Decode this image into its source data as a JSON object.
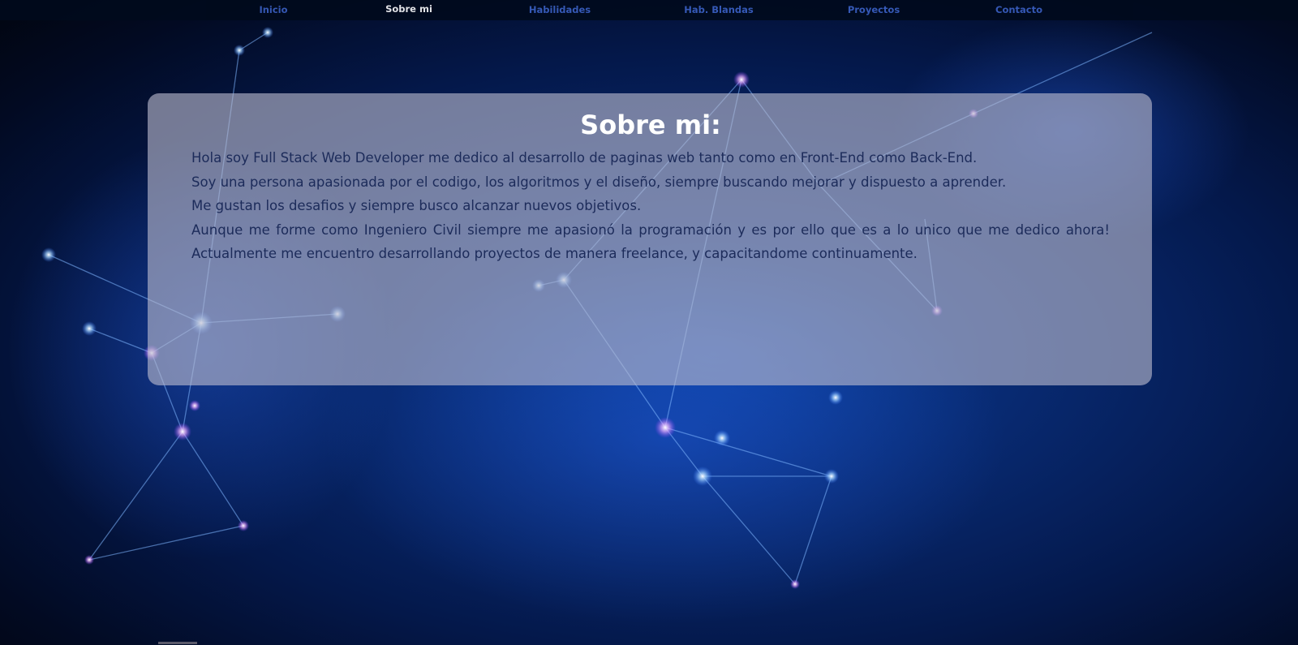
{
  "nav": {
    "items": [
      {
        "label": "Inicio"
      },
      {
        "label": "Sobre mi"
      },
      {
        "label": "Habilidades"
      },
      {
        "label": "Hab. Blandas"
      },
      {
        "label": "Proyectos"
      },
      {
        "label": "Contacto"
      }
    ],
    "active_index": 1
  },
  "about": {
    "title": "Sobre mi:",
    "paragraphs": [
      "Hola soy Full Stack Web Developer me dedico al desarrollo de paginas web tanto como en Front-End como Back-End.",
      "Soy una persona apasionada por el codigo, los algoritmos y el diseño, siempre buscando mejorar y dispuesto a aprender.",
      "Me gustan los desafios y siempre busco alcanzar nuevos objetivos.",
      "Aunque me forme como Ingeniero Civil siempre me apasionó la programación y es por ello que es a lo unico que me dedico ahora! Actualmente me encuentro desarrollando proyectos de manera freelance, y capacitandome continuamente."
    ]
  },
  "colors": {
    "nav_link": "#3d63c8",
    "nav_active": "#ffffff",
    "card_text": "#1c2b5a",
    "background": "#082a72"
  },
  "icons": {
    "background": "network-nodes-background"
  }
}
